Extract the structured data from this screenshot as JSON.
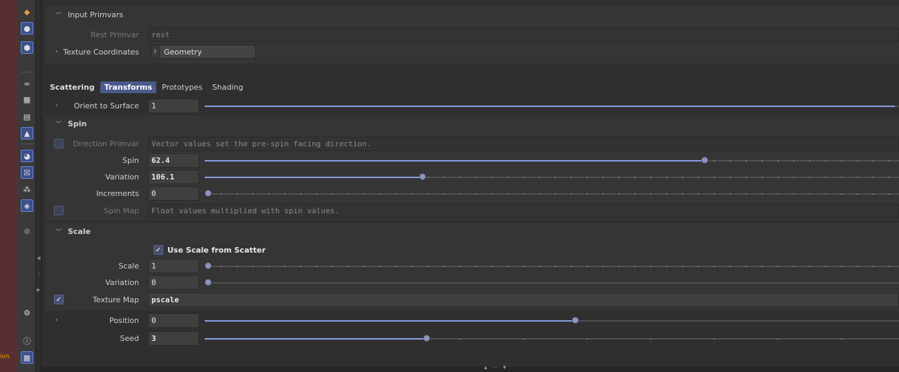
{
  "viewport": {
    "hint_text": "ion"
  },
  "input_primvars": {
    "title": "Input Primvars",
    "rest_primvar": {
      "label": "Rest Primvar",
      "value": "rest"
    },
    "texture_coordinates": {
      "label": "Texture Coordinates",
      "value": "Geometry"
    }
  },
  "tabs": [
    "Scattering",
    "Transforms",
    "Prototypes",
    "Shading"
  ],
  "selected_tab": "Transforms",
  "orient_to_surface": {
    "label": "Orient to Surface",
    "value": "1",
    "level": 1.0
  },
  "spin_section": {
    "title": "Spin",
    "direction_primvar": {
      "label": "Direction Primvar",
      "placeholder": "Vector values set the pre-spin facing direction."
    },
    "spin": {
      "label": "Spin",
      "value": "62.4",
      "level": 0.722
    },
    "variation": {
      "label": "Variation",
      "value": "106.1",
      "level": 0.314
    },
    "increments": {
      "label": "Increments",
      "value": "0",
      "level": 0.0
    },
    "spin_map": {
      "label": "Spin Map",
      "placeholder": "Float values multiplied with spin values."
    }
  },
  "scale_section": {
    "title": "Scale",
    "use_scale_from_scatter": {
      "label": "Use Scale from Scatter",
      "checked": true
    },
    "scale": {
      "label": "Scale",
      "value": "1",
      "level": 0.0
    },
    "variation": {
      "label": "Variation",
      "value": "0",
      "level": 0.0
    },
    "texture_map": {
      "label": "Texture Map",
      "value": "pscale",
      "checked": true
    }
  },
  "position": {
    "label": "Position",
    "value": "0",
    "level": 0.535
  },
  "seed": {
    "label": "Seed",
    "value": "3",
    "level": 0.32
  },
  "colors": {
    "accent": "#8aa0e6",
    "selected_tab": "#4a5a8c",
    "panel": "#2f2f2f"
  }
}
